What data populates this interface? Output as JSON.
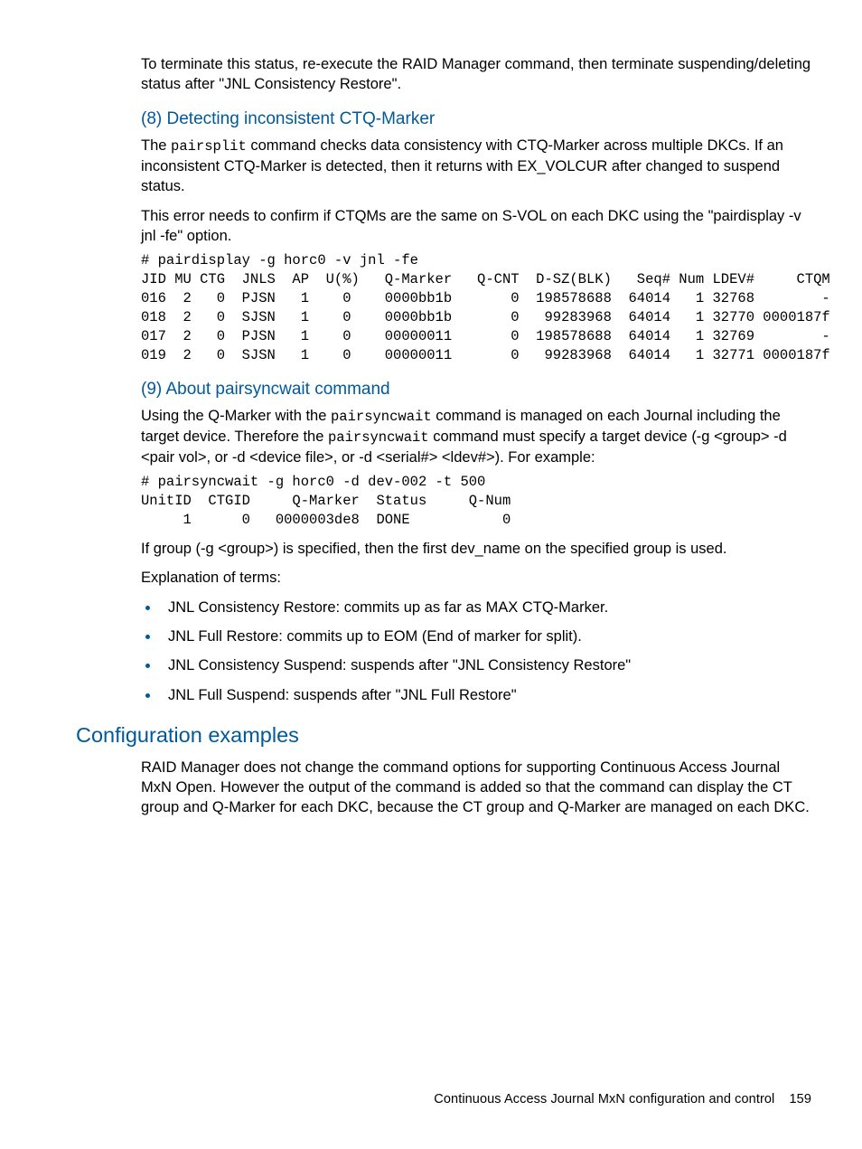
{
  "intro": {
    "p1": "To terminate this status, re-execute the RAID Manager command, then terminate suspending/deleting status after \"JNL Consistency Restore\"."
  },
  "sec8": {
    "heading": "(8) Detecting inconsistent CTQ-Marker",
    "p1a": "The ",
    "p1code": "pairsplit",
    "p1b": " command checks data consistency with CTQ-Marker across multiple DKCs. If an inconsistent CTQ-Marker is detected, then it returns with EX_VOLCUR after changed to suspend status.",
    "p2": "This error needs to confirm if CTQMs are the same on S-VOL on each DKC using the \"pairdisplay -v jnl -fe\" option.",
    "code": "# pairdisplay -g horc0 -v jnl -fe\nJID MU CTG  JNLS  AP  U(%)   Q-Marker   Q-CNT  D-SZ(BLK)   Seq# Num LDEV#     CTQM\n016  2   0  PJSN   1    0    0000bb1b       0  198578688  64014   1 32768        -\n018  2   0  SJSN   1    0    0000bb1b       0   99283968  64014   1 32770 0000187f\n017  2   0  PJSN   1    0    00000011       0  198578688  64014   1 32769        -\n019  2   0  SJSN   1    0    00000011       0   99283968  64014   1 32771 0000187f"
  },
  "sec9": {
    "heading": "(9) About pairsyncwait command",
    "p1a": "Using the Q-Marker with the ",
    "p1code1": "pairsyncwait",
    "p1b": " command is managed on each Journal including the target device. Therefore the ",
    "p1code2": "pairsyncwait",
    "p1c": " command must specify a target device (-g <group> -d <pair vol>, or -d <device file>, or -d <serial#> <ldev#>). For example:",
    "code": "# pairsyncwait -g horc0 -d dev-002 -t 500\nUnitID  CTGID     Q-Marker  Status     Q-Num\n     1      0   0000003de8  DONE           0",
    "p2": "If group (-g <group>) is specified, then the first dev_name on the specified group is used.",
    "p3": "Explanation of terms:",
    "terms": [
      "JNL Consistency Restore: commits up as far as MAX CTQ-Marker.",
      "JNL Full Restore: commits up to EOM (End of marker for split).",
      "JNL Consistency Suspend: suspends after \"JNL Consistency Restore\"",
      "JNL Full Suspend: suspends after \"JNL Full Restore\""
    ]
  },
  "config": {
    "heading": "Configuration examples",
    "p1": "RAID Manager does not change the command options for supporting Continuous Access Journal MxN Open. However the output of the command is added so that the command can display the CT group and Q-Marker for each DKC, because the CT group and Q-Marker are managed on each DKC."
  },
  "footer": {
    "text": "Continuous Access Journal MxN configuration and control",
    "page": "159"
  }
}
